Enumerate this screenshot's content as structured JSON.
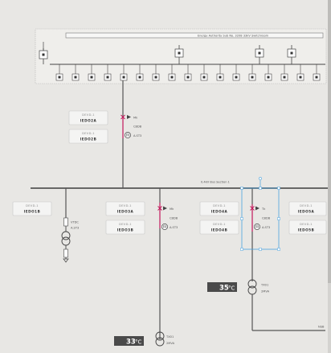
{
  "switchgear": {
    "title": "Energy Authority Sub No. 3208 33kV Switchroom"
  },
  "main_bus": {
    "label": "0.4kV Bus Section 1"
  },
  "feeder_top": {
    "label_a": "Mk",
    "label_b": "CBDB",
    "label_c": "A.ST3"
  },
  "feeder_mid": {
    "label_a": "Mk",
    "label_b": "CBDB",
    "label_c": "A.ST3"
  },
  "feeder_selected": {
    "label_a": "Tk",
    "label_b": "CBDB",
    "label_c": "A.ST3"
  },
  "left_branch": {
    "label_a": "VTDC",
    "label_b": "A.ST3"
  },
  "cards": [
    {
      "top": "DEVD-1",
      "bottom": "IEDO2A"
    },
    {
      "top": "DEVD-1",
      "bottom": "IEDO2B"
    },
    {
      "top": "DEVD-1",
      "bottom": "IEDO1B"
    },
    {
      "top": "DEVD-1",
      "bottom": "IEDO3A"
    },
    {
      "top": "DEVD-1",
      "bottom": "IEDO3B"
    },
    {
      "top": "DEVD-1",
      "bottom": "IEDO4A"
    },
    {
      "top": "DEVD-1",
      "bottom": "IEDO4B"
    },
    {
      "top": "DEVD-1",
      "bottom": "IEDO5A"
    },
    {
      "top": "DEVD-1",
      "bottom": "IEDO5B"
    }
  ],
  "transformers": [
    {
      "label_a": "TX01",
      "label_b": "2MVA",
      "temperature": "35",
      "unit": "°C"
    },
    {
      "label_a": "TX01",
      "label_b": "2MVA",
      "temperature": "33",
      "unit": "°C"
    }
  ],
  "corner_label": "NSB",
  "colors": {
    "background": "#e8e7e4",
    "line": "#555555",
    "selected_line": "#c2185b",
    "selection": "#4aa3df",
    "card_bg": "#f4f4f3",
    "temp_bg": "#4a4a4a"
  }
}
